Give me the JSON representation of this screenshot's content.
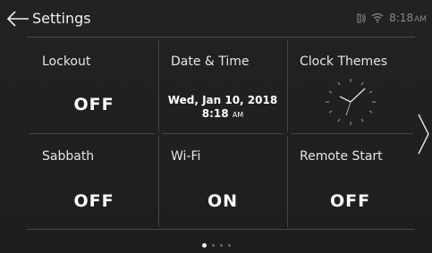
{
  "header": {
    "title": "Settings",
    "time": "8:18",
    "ampm": "AM",
    "icons": [
      "back-arrow-icon",
      "remote-signal-icon",
      "wifi-icon"
    ]
  },
  "tiles": [
    {
      "label": "Lockout",
      "value": "OFF"
    },
    {
      "label": "Date & Time",
      "date": "Wed, Jan 10, 2018",
      "time": "8:18",
      "ampm": "AM"
    },
    {
      "label": "Clock Themes",
      "icon": "analog-clock-icon"
    },
    {
      "label": "Sabbath",
      "value": "OFF"
    },
    {
      "label": "Wi-Fi",
      "value": "ON"
    },
    {
      "label": "Remote Start",
      "value": "OFF"
    }
  ],
  "navigation": {
    "next_icon": "chevron-right-icon",
    "page_count": 4,
    "current_page": 1
  },
  "colors": {
    "background": "#1c1c1c",
    "text": "#e8e8e8",
    "value": "#ffffff",
    "divider": "#444444",
    "status": "#8a8a8a"
  }
}
